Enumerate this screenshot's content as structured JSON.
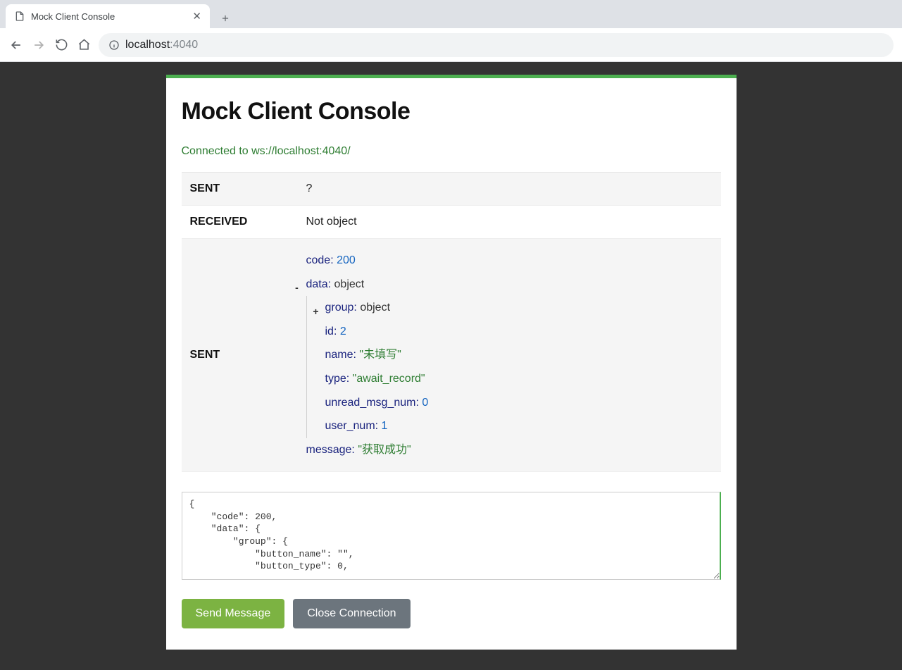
{
  "browser": {
    "tab_title": "Mock Client Console",
    "url_host": "localhost",
    "url_port": ":4040"
  },
  "page": {
    "title": "Mock Client Console",
    "status": "Connected to ws://localhost:4040/"
  },
  "log": {
    "labels": {
      "sent": "SENT",
      "received": "RECEIVED"
    },
    "rows": [
      {
        "label": "SENT",
        "value": "?"
      },
      {
        "label": "RECEIVED",
        "value": "Not object"
      }
    ],
    "tree": {
      "code_key": "code",
      "code_val": "200",
      "data_key": "data",
      "data_type": "object",
      "group_key": "group",
      "group_type": "object",
      "id_key": "id",
      "id_val": "2",
      "name_key": "name",
      "name_val": "\"未填写\"",
      "type_key": "type",
      "type_val": "\"await_record\"",
      "unread_key": "unread_msg_num",
      "unread_val": "0",
      "usernum_key": "user_num",
      "usernum_val": "1",
      "message_key": "message",
      "message_val": "\"获取成功\""
    }
  },
  "input": {
    "value": "{\n    \"code\": 200,\n    \"data\": {\n        \"group\": {\n            \"button_name\": \"\",\n            \"button_type\": 0,"
  },
  "buttons": {
    "send": "Send Message",
    "close": "Close Connection"
  }
}
